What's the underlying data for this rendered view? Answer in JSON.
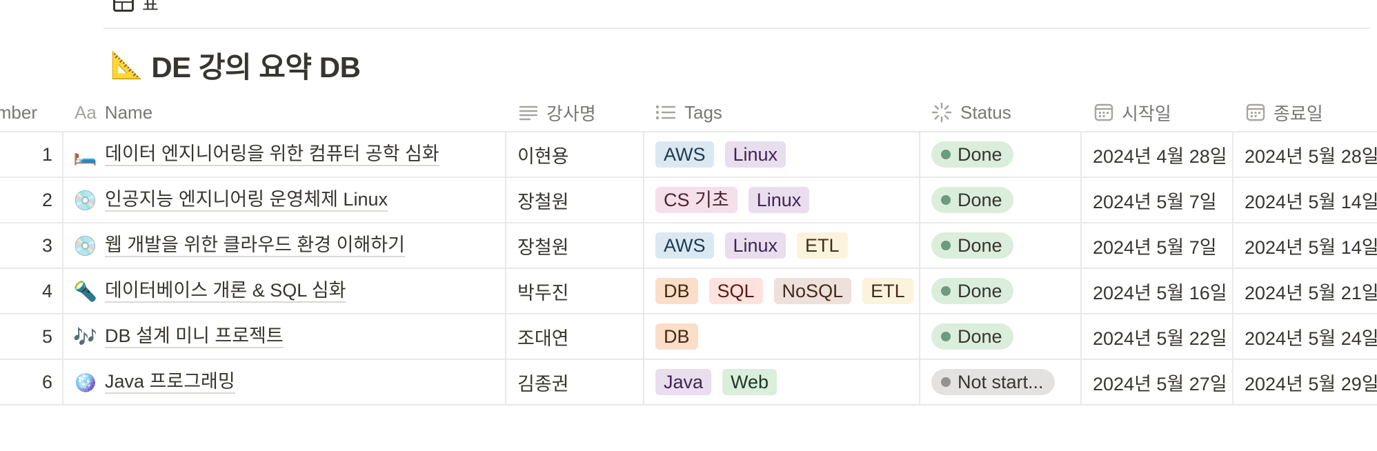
{
  "view_tab": {
    "label": "표"
  },
  "page": {
    "icon": "📐",
    "title": "DE 강의 요약 DB"
  },
  "columns": {
    "number": "Number",
    "name": "Name",
    "instructor": "강사명",
    "tags": "Tags",
    "status": "Status",
    "start": "시작일",
    "end": "종료일"
  },
  "rows": [
    {
      "number": "1",
      "icon": "🛏️",
      "name": "데이터 엔지니어링을 위한 컴퓨터 공학 심화",
      "instructor": "이현용",
      "tags": [
        {
          "label": "AWS",
          "bg": "#dbe8f1",
          "fg": "#1d3b52"
        },
        {
          "label": "Linux",
          "bg": "#e8deee",
          "fg": "#412454"
        }
      ],
      "status": {
        "label": "Done",
        "bg": "#dbeddb",
        "dot": "#6c9b7d"
      },
      "start": "2024년 4월 28일",
      "end": "2024년 5월 28일"
    },
    {
      "number": "2",
      "icon": "💿",
      "name": "인공지능 엔지니어링 운영체제 Linux",
      "instructor": "장철원",
      "tags": [
        {
          "label": "CS 기초",
          "bg": "#f5e0e9",
          "fg": "#4c2337"
        },
        {
          "label": "Linux",
          "bg": "#e8deee",
          "fg": "#412454"
        }
      ],
      "status": {
        "label": "Done",
        "bg": "#dbeddb",
        "dot": "#6c9b7d"
      },
      "start": "2024년 5월 7일",
      "end": "2024년 5월 14일"
    },
    {
      "number": "3",
      "icon": "💿",
      "name": "웹 개발을 위한 클라우드 환경 이해하기",
      "instructor": "장철원",
      "tags": [
        {
          "label": "AWS",
          "bg": "#dbe8f1",
          "fg": "#1d3b52"
        },
        {
          "label": "Linux",
          "bg": "#e8deee",
          "fg": "#412454"
        },
        {
          "label": "ETL",
          "bg": "#fbf3db",
          "fg": "#402c1b"
        }
      ],
      "status": {
        "label": "Done",
        "bg": "#dbeddb",
        "dot": "#6c9b7d"
      },
      "start": "2024년 5월 7일",
      "end": "2024년 5월 14일"
    },
    {
      "number": "4",
      "icon": "🔦",
      "name": "데이터베이스 개론 & SQL 심화",
      "instructor": "박두진",
      "tags": [
        {
          "label": "DB",
          "bg": "#fadec9",
          "fg": "#49290e"
        },
        {
          "label": "SQL",
          "bg": "#ffe2dd",
          "fg": "#5d1715"
        },
        {
          "label": "NoSQL",
          "bg": "#eee0da",
          "fg": "#442a1e"
        },
        {
          "label": "ETL",
          "bg": "#fbf3db",
          "fg": "#402c1b"
        }
      ],
      "status": {
        "label": "Done",
        "bg": "#dbeddb",
        "dot": "#6c9b7d"
      },
      "start": "2024년 5월 16일",
      "end": "2024년 5월 21일"
    },
    {
      "number": "5",
      "icon": "🎶",
      "name": "DB 설계 미니 프로젝트",
      "instructor": "조대연",
      "tags": [
        {
          "label": "DB",
          "bg": "#fadec9",
          "fg": "#49290e"
        }
      ],
      "status": {
        "label": "Done",
        "bg": "#dbeddb",
        "dot": "#6c9b7d"
      },
      "start": "2024년 5월 22일",
      "end": "2024년 5월 24일"
    },
    {
      "number": "6",
      "icon": "🪩",
      "name": "Java 프로그래밍",
      "instructor": "김종권",
      "tags": [
        {
          "label": "Java",
          "bg": "#e8deee",
          "fg": "#412454"
        },
        {
          "label": "Web",
          "bg": "#dbeddb",
          "fg": "#1c3829"
        }
      ],
      "status": {
        "label": "Not start...",
        "bg": "#e3e2e0",
        "dot": "#91918e"
      },
      "start": "2024년 5월 27일",
      "end": "2024년 5월 29일"
    }
  ],
  "icons": {
    "view": "table-icon",
    "name_col": "text-aa-icon",
    "instructor_col": "text-lines-icon",
    "tags_col": "list-icon",
    "status_col": "status-spinner-icon",
    "date_col": "calendar-icon"
  }
}
